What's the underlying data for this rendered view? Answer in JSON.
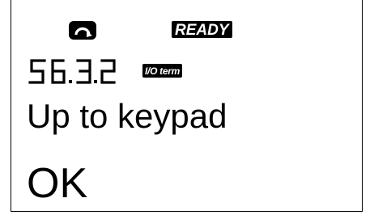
{
  "status": {
    "control_icon": "rotation-direction-icon",
    "ready_label": "READY"
  },
  "parameter": {
    "code": "56.3.2",
    "control_place": "I/O term"
  },
  "menu": {
    "title": "Up to keypad",
    "value": "OK"
  }
}
